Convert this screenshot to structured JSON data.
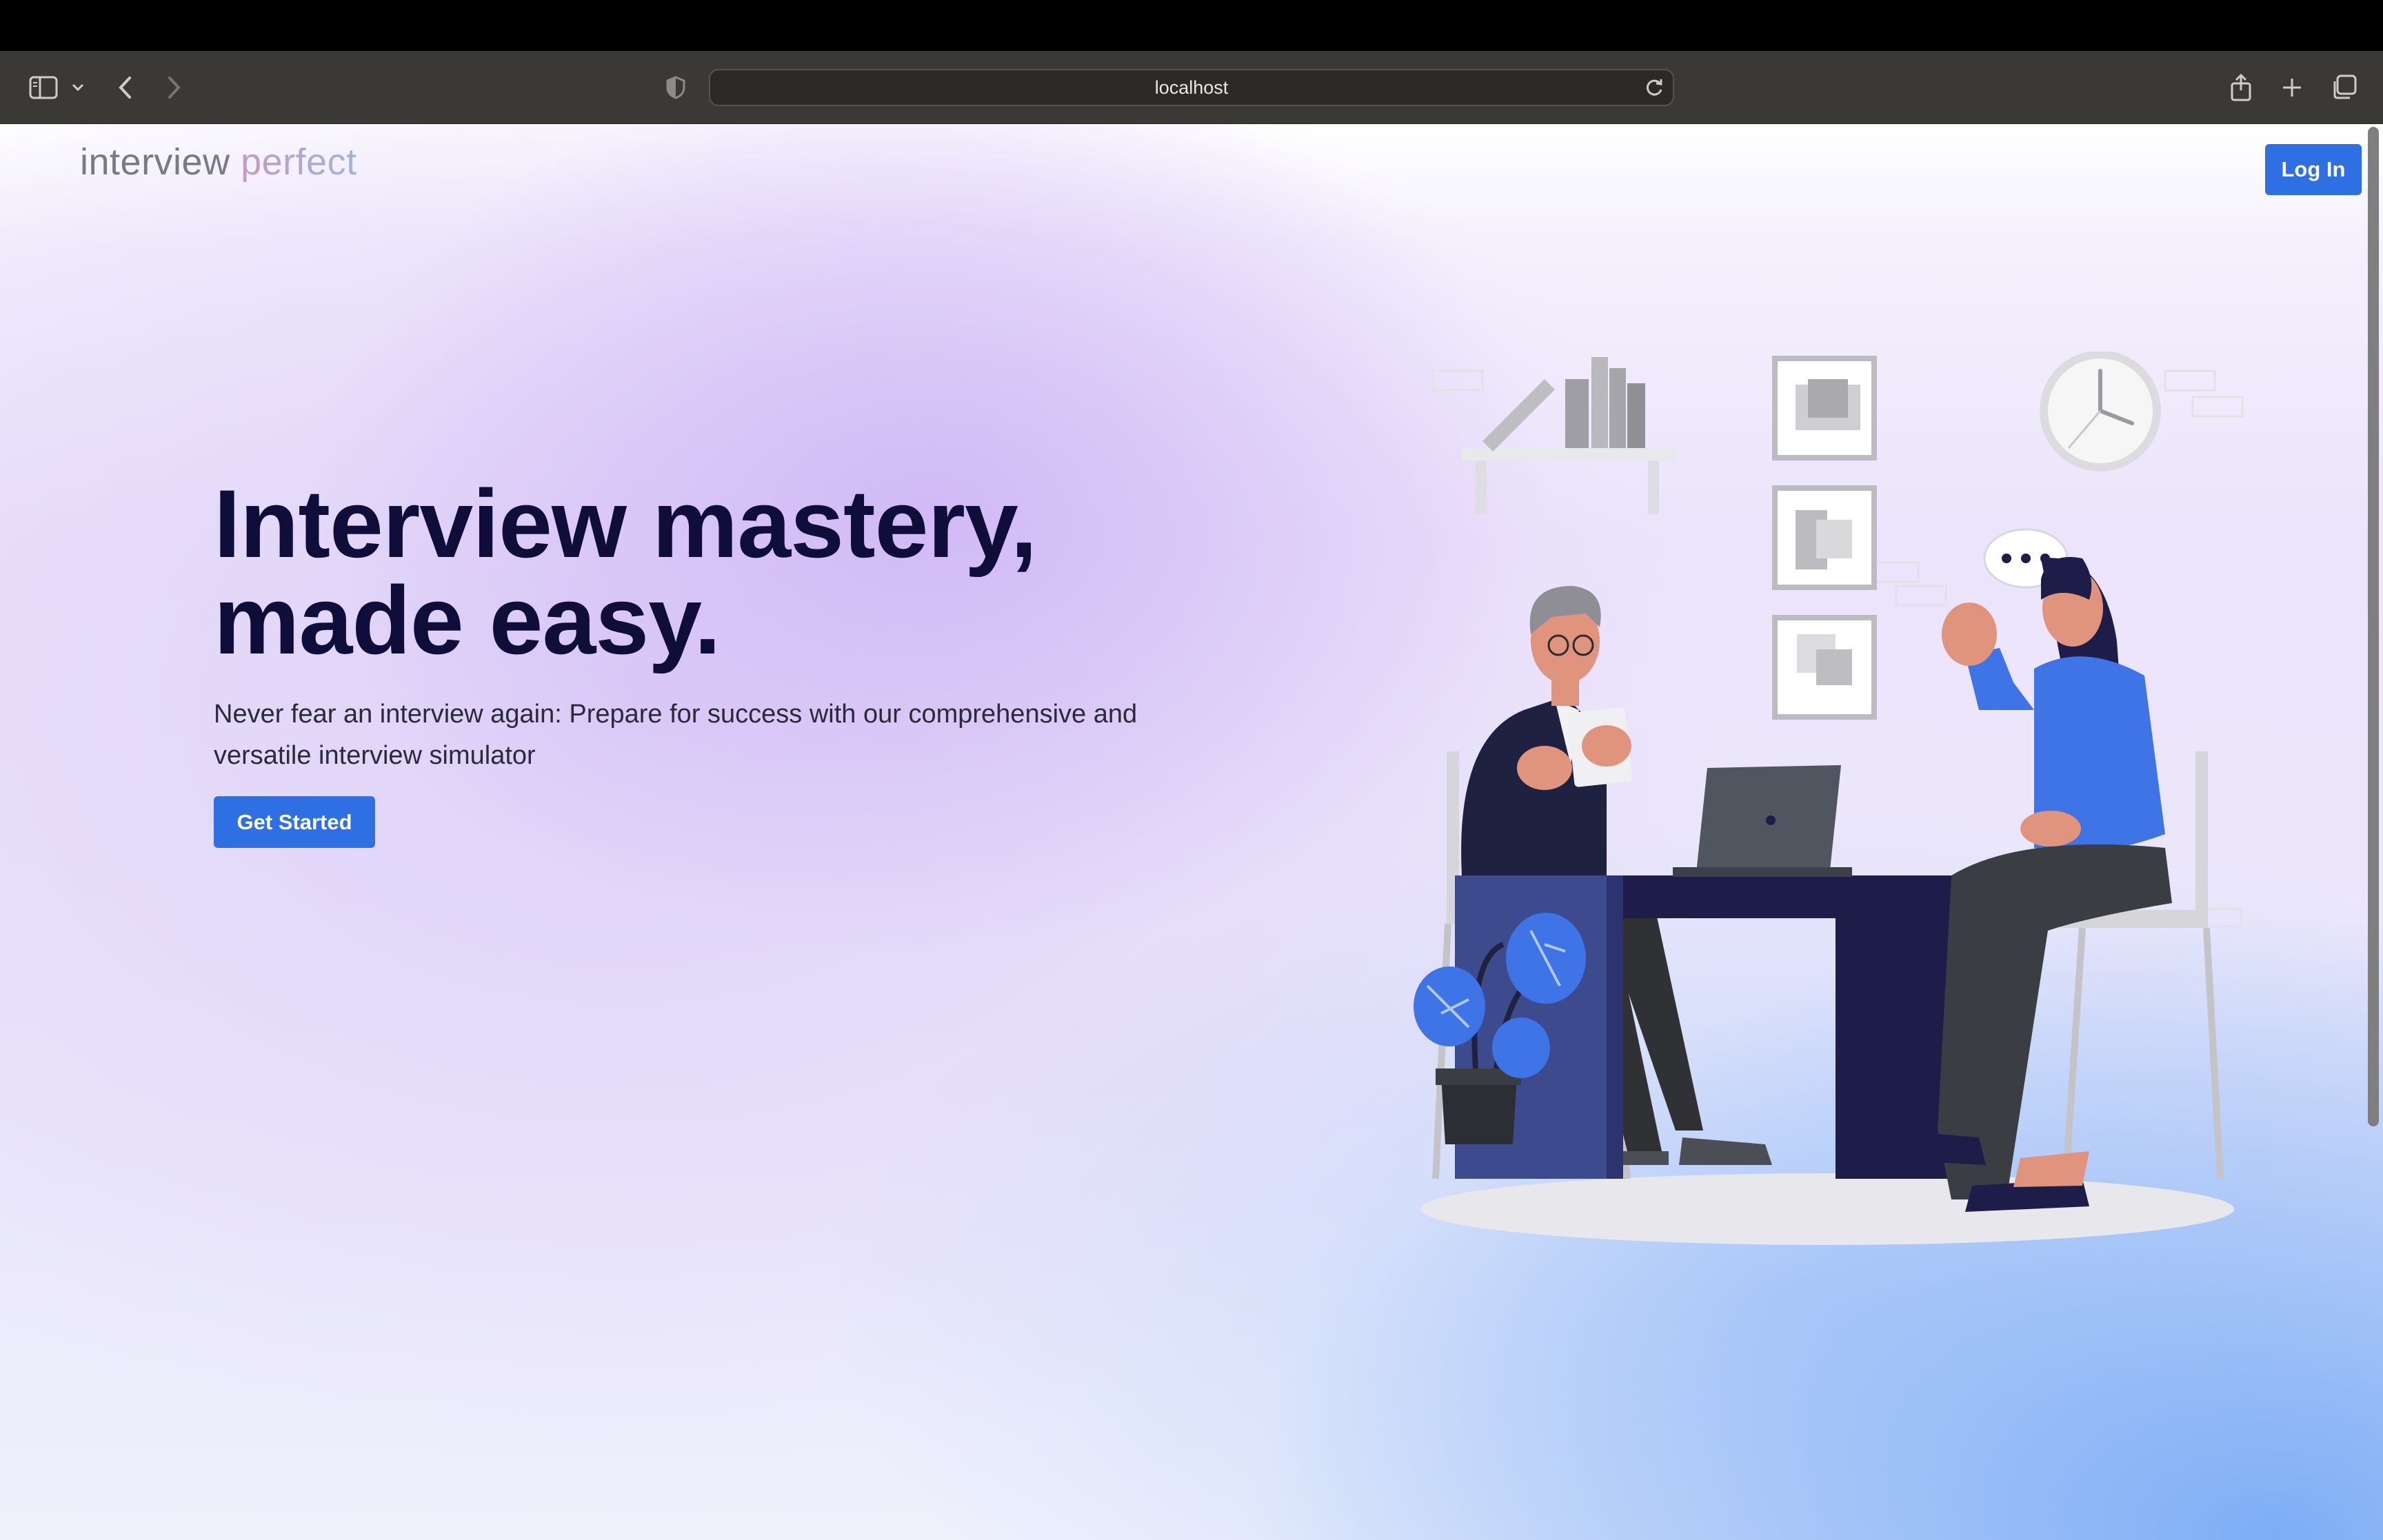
{
  "browser": {
    "url": "localhost",
    "icons": [
      "sidebar-icon",
      "chevron-down-icon",
      "back-icon",
      "forward-icon",
      "shield-icon",
      "reload-icon",
      "share-icon",
      "new-tab-icon",
      "tabs-overview-icon"
    ]
  },
  "header": {
    "logo_part1": "interview",
    "logo_part2": "perfect",
    "login_label": "Log In"
  },
  "hero": {
    "title_line1": "Interview mastery,",
    "title_line2": "made easy.",
    "subtitle_line1": "Never fear an interview again: Prepare for success with our comprehensive and",
    "subtitle_line2": "versatile interview simulator",
    "cta_label": "Get Started"
  },
  "colors": {
    "primary": "#2f6fe4",
    "heading": "#0f0e3a",
    "body_text": "#2a2a3a",
    "illustration_blue": "#3f74e6",
    "illustration_navy": "#1e1d4a"
  }
}
